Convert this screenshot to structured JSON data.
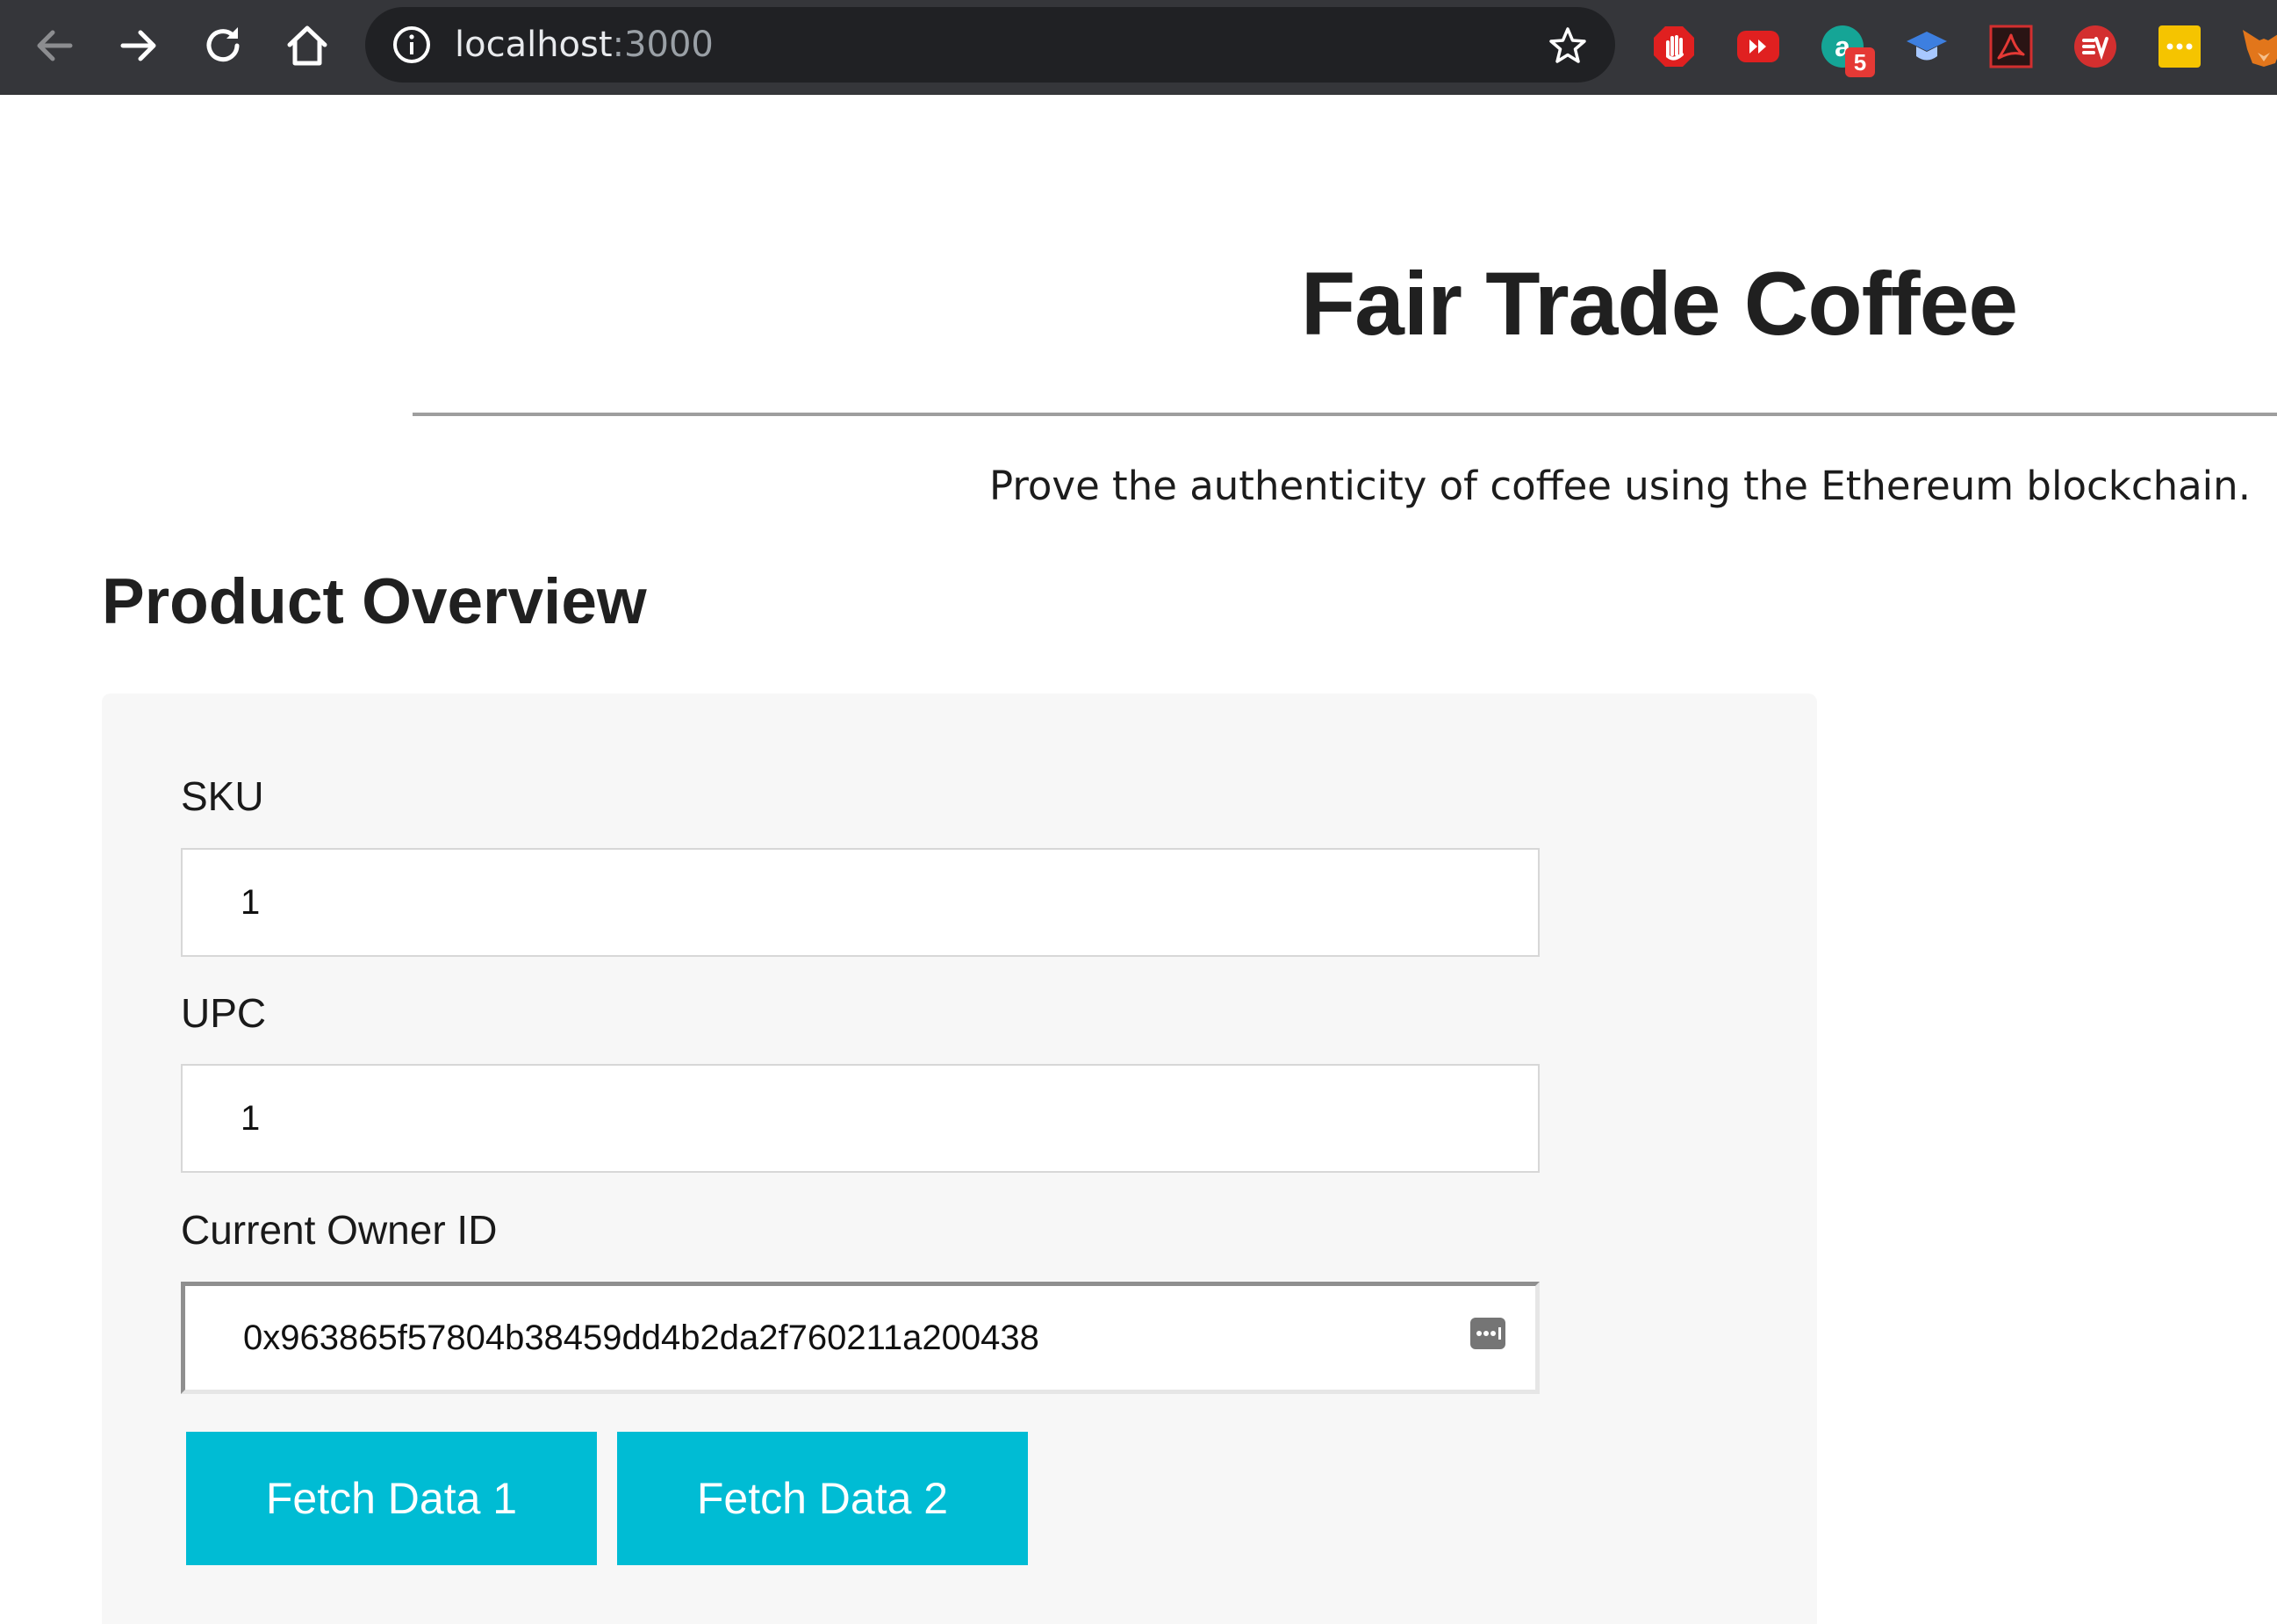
{
  "browser": {
    "url_host": "localhost",
    "url_port": ":3000",
    "extensions": {
      "badge_count": "5"
    }
  },
  "page": {
    "title": "Fair Trade Coffee",
    "subtitle": "Prove the authenticity of coffee using the Ethereum blockchain.",
    "section_title": "Product Overview"
  },
  "form": {
    "sku": {
      "label": "SKU",
      "value": "1"
    },
    "upc": {
      "label": "UPC",
      "value": "1"
    },
    "owner": {
      "label": "Current Owner ID",
      "value": "0x963865f57804b38459dd4b2da2f760211a200438"
    }
  },
  "buttons": {
    "fetch1": "Fetch Data 1",
    "fetch2": "Fetch Data 2"
  },
  "colors": {
    "button_bg": "#00bcd4",
    "chrome_bg": "#35363a",
    "panel_bg": "#f7f7f7"
  }
}
